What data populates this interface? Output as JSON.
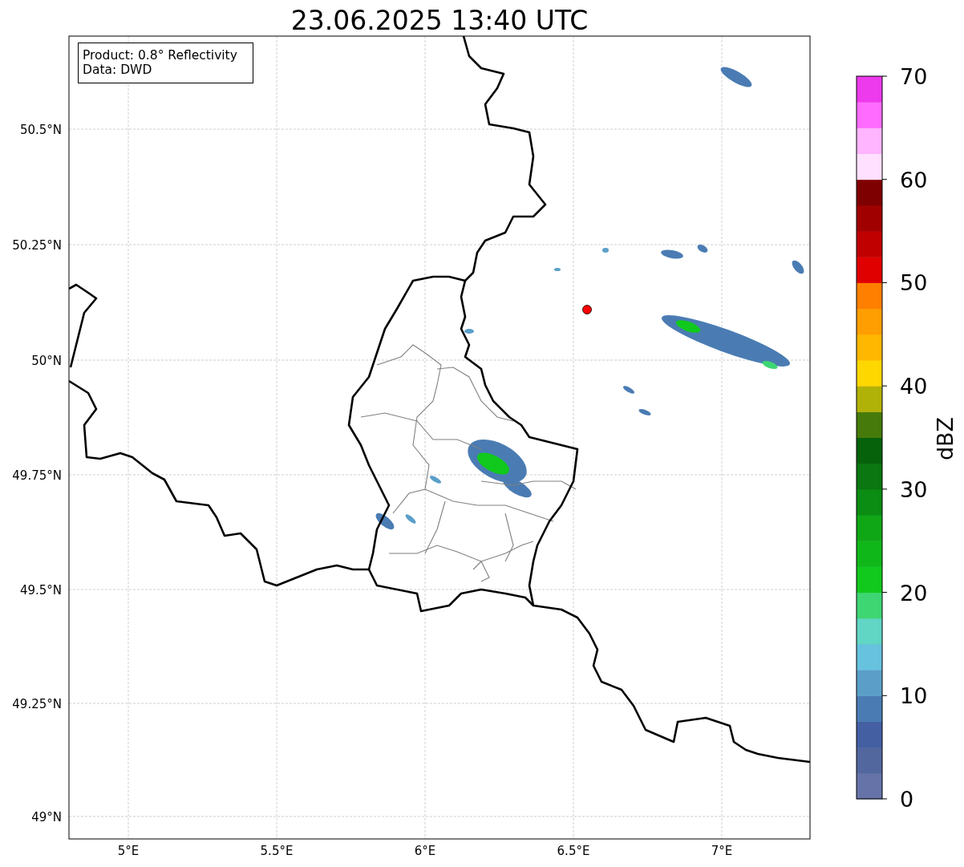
{
  "title": "23.06.2025 13:40 UTC",
  "annotation": [
    "Product: 0.8° Reflectivity",
    "Data: DWD"
  ],
  "map": {
    "x_ticks": [
      "5°E",
      "5.5°E",
      "6°E",
      "6.5°E",
      "7°E"
    ],
    "y_ticks": [
      "50.5°N",
      "50.25°N",
      "50°N",
      "49.75°N",
      "49.5°N",
      "49.25°N",
      "49°N"
    ]
  },
  "colorbar": {
    "label": "dBZ",
    "ticks": [
      "70",
      "60",
      "50",
      "40",
      "30",
      "20",
      "10",
      "0"
    ],
    "bins": [
      {
        "color": "#6573a8"
      },
      {
        "color": "#53679f"
      },
      {
        "color": "#4460a3"
      },
      {
        "color": "#4a7cb3"
      },
      {
        "color": "#5b9fc9"
      },
      {
        "color": "#66c2de"
      },
      {
        "color": "#62d6c4"
      },
      {
        "color": "#3ed672"
      },
      {
        "color": "#10c91c"
      },
      {
        "color": "#10b719"
      },
      {
        "color": "#10a716"
      },
      {
        "color": "#0b8c13"
      },
      {
        "color": "#0a7710"
      },
      {
        "color": "#07620c"
      },
      {
        "color": "#467a0b"
      },
      {
        "color": "#b1b207"
      },
      {
        "color": "#ffd700"
      },
      {
        "color": "#ffb700"
      },
      {
        "color": "#ff9e00"
      },
      {
        "color": "#ff7f00"
      },
      {
        "color": "#e00000"
      },
      {
        "color": "#c00000"
      },
      {
        "color": "#a00000"
      },
      {
        "color": "#7f0000"
      },
      {
        "color": "#ffe0ff"
      },
      {
        "color": "#ffb5ff"
      },
      {
        "color": "#ff6bff"
      },
      {
        "color": "#ec3aec"
      }
    ]
  }
}
